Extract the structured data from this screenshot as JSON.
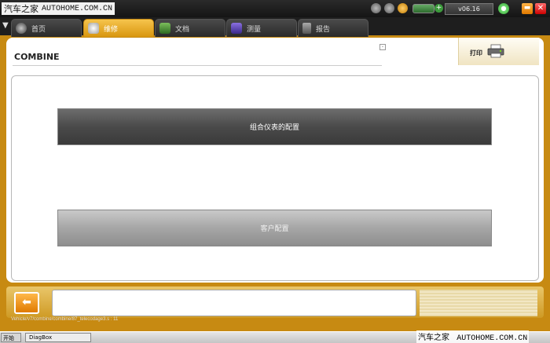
{
  "watermark": {
    "logo": "汽车之家",
    "url": "AUTOHOME.COM.CN"
  },
  "titlebar": {
    "version": "v06.16"
  },
  "tabs": [
    {
      "label": "首页",
      "icon": "home-icon"
    },
    {
      "label": "维修",
      "icon": "wrench-icon",
      "active": true
    },
    {
      "label": "文档",
      "icon": "document-icon"
    },
    {
      "label": "测量",
      "icon": "waveform-icon"
    },
    {
      "label": "报告",
      "icon": "report-icon"
    }
  ],
  "page": {
    "title": "COMBINE",
    "print_label": "打印",
    "buttons": {
      "cluster_config": "组合仪表的配置",
      "customer_config": "客户配置"
    }
  },
  "status": {
    "path": "Vehicle/v7/combine/combine/87_telecodage3.s : 11"
  },
  "taskbar": {
    "start": "开始",
    "item": "DiagBox"
  },
  "colors": {
    "accent": "#c78a12",
    "dark_button": "#4a4a4a",
    "light_button": "#a6a6a6"
  }
}
